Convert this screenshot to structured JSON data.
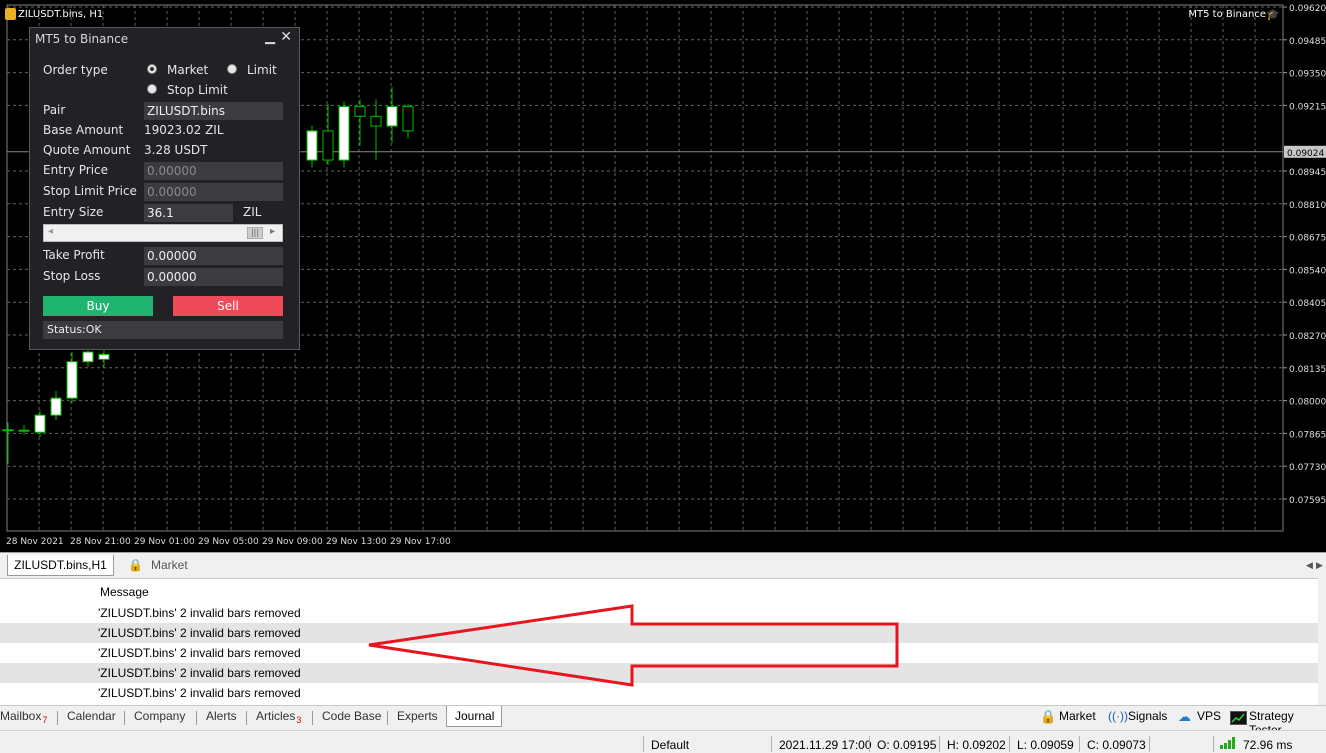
{
  "chart": {
    "title": "ZILUSDT.bins, H1",
    "ea_label": "MT5 to Binance",
    "current_price": "0.09024",
    "price_ticks": [
      "0.09620",
      "0.09485",
      "0.09350",
      "0.09215",
      "0.08945",
      "0.08810",
      "0.08675",
      "0.08540",
      "0.08405",
      "0.08270",
      "0.08135",
      "0.08000",
      "0.07865",
      "0.07730",
      "0.07595"
    ],
    "time_ticks": [
      "28 Nov 2021",
      "28 Nov 21:00",
      "29 Nov 01:00",
      "29 Nov 05:00",
      "29 Nov 09:00",
      "29 Nov 13:00",
      "29 Nov 17:00"
    ],
    "colors": {
      "background": "#000000",
      "bull_candle": "#ffffff",
      "wick": "#00c000",
      "grid": "#5a6a5a"
    }
  },
  "chart_data": {
    "type": "candlestick",
    "visible_candles": [
      {
        "o": 0.0788,
        "h": 0.0791,
        "l": 0.0774,
        "c": 0.0788
      },
      {
        "o": 0.07878,
        "h": 0.079,
        "l": 0.0786,
        "c": 0.07878
      },
      {
        "o": 0.0787,
        "h": 0.0796,
        "l": 0.0785,
        "c": 0.0794
      },
      {
        "o": 0.0794,
        "h": 0.0804,
        "l": 0.0792,
        "c": 0.0801
      },
      {
        "o": 0.0801,
        "h": 0.082,
        "l": 0.0799,
        "c": 0.0816
      },
      {
        "o": 0.0816,
        "h": 0.0825,
        "l": 0.0814,
        "c": 0.082
      },
      {
        "o": 0.0817,
        "h": 0.0824,
        "l": 0.0814,
        "c": 0.0819
      },
      {
        "o": 0.0899,
        "h": 0.0913,
        "l": 0.0896,
        "c": 0.0911
      },
      {
        "o": 0.0911,
        "h": 0.0922,
        "l": 0.0897,
        "c": 0.0899
      },
      {
        "o": 0.0899,
        "h": 0.0923,
        "l": 0.0896,
        "c": 0.0921
      },
      {
        "o": 0.0921,
        "h": 0.0924,
        "l": 0.0905,
        "c": 0.0917
      },
      {
        "o": 0.0917,
        "h": 0.0924,
        "l": 0.0899,
        "c": 0.0913
      },
      {
        "o": 0.0913,
        "h": 0.0929,
        "l": 0.0906,
        "c": 0.0921
      },
      {
        "o": 0.0921,
        "h": 0.0922,
        "l": 0.0908,
        "c": 0.0911
      }
    ]
  },
  "dialog": {
    "title": "MT5 to Binance",
    "order_type_label": "Order type",
    "order_types": [
      "Market",
      "Limit",
      "Stop Limit"
    ],
    "selected_order_type": "Market",
    "pair_label": "Pair",
    "pair_value": "ZILUSDT.bins",
    "base_amount_label": "Base Amount",
    "base_amount_value": "19023.02 ZIL",
    "quote_amount_label": "Quote Amount",
    "quote_amount_value": "3.28 USDT",
    "entry_price_label": "Entry Price",
    "entry_price_value": "0.00000",
    "stop_limit_price_label": "Stop Limit Price",
    "stop_limit_price_value": "0.00000",
    "entry_size_label": "Entry Size",
    "entry_size_value": "36.1",
    "entry_size_unit": "ZIL",
    "take_profit_label": "Take Profit",
    "take_profit_value": "0.00000",
    "stop_loss_label": "Stop Loss",
    "stop_loss_value": "0.00000",
    "buy_label": "Buy",
    "sell_label": "Sell",
    "status_text": "Status:OK",
    "colors": {
      "buy": "#1fb571",
      "sell": "#ee4a5a"
    }
  },
  "chart_tabs": {
    "active": "ZILUSDT.bins,H1",
    "other": "Market"
  },
  "journal": {
    "column_message": "Message",
    "rows": [
      "'ZILUSDT.bins' 2 invalid bars removed",
      "'ZILUSDT.bins' 2 invalid bars removed",
      "'ZILUSDT.bins' 2 invalid bars removed",
      "'ZILUSDT.bins' 2 invalid bars removed",
      "'ZILUSDT.bins' 2 invalid bars removed"
    ]
  },
  "bottom_tabs": {
    "mailbox": "Mailbox",
    "mailbox_count": "7",
    "calendar": "Calendar",
    "company": "Company",
    "alerts": "Alerts",
    "articles": "Articles",
    "articles_count": "3",
    "code_base": "Code Base",
    "experts": "Experts",
    "journal": "Journal",
    "market": "Market",
    "signals": "Signals",
    "vps": "VPS",
    "strategy_tester": "Strategy Tester"
  },
  "statusbar": {
    "profile": "Default",
    "time": "2021.11.29 17:00",
    "open": "O: 0.09195",
    "high": "H: 0.09202",
    "low": "L: 0.09059",
    "close": "C: 0.09073",
    "ping": "72.96 ms"
  },
  "annotation": {
    "arrow_color": "#e8141e"
  }
}
